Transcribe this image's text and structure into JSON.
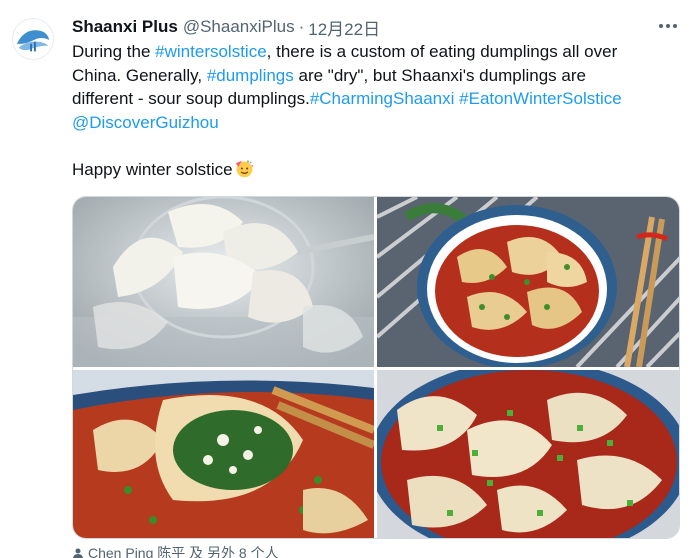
{
  "author": {
    "name": "Shaanxi Plus",
    "handle": "@ShaanxiPlus",
    "separator": "·",
    "date": "12月22日"
  },
  "tweet": {
    "line1": {
      "pre": "During the ",
      "tag": "#wintersolstice",
      "post": ", there is a custom of eating dumplings all over"
    },
    "line2": {
      "pre": "China. Generally, ",
      "tag": "#dumplings",
      "post": " are \"dry\", but Shaanxi's dumplings are"
    },
    "line3": {
      "pre": "different - sour soup dumplings.",
      "tag1": "#CharmingShaanxi",
      "gap": " ",
      "tag2": "#EatonWinterSolstice"
    },
    "line4": {
      "tag": "@DiscoverGuizhou"
    },
    "greeting": "Happy winter solstice",
    "emoji": "partying-face-emoji"
  },
  "media": {
    "count": 4,
    "images": [
      "dumplings-in-strainer",
      "sour-soup-dumplings-bowl",
      "dumpling-filling-closeup",
      "dumplings-with-scallions"
    ]
  },
  "tagged_users": {
    "text": "Chen Ping 陈平 及 另外 8 个人",
    "icon": "person-icon"
  },
  "colors": {
    "link": "#1d9bf0",
    "text": "#0f1419",
    "secondary": "#536471",
    "border": "#cfd9de"
  }
}
